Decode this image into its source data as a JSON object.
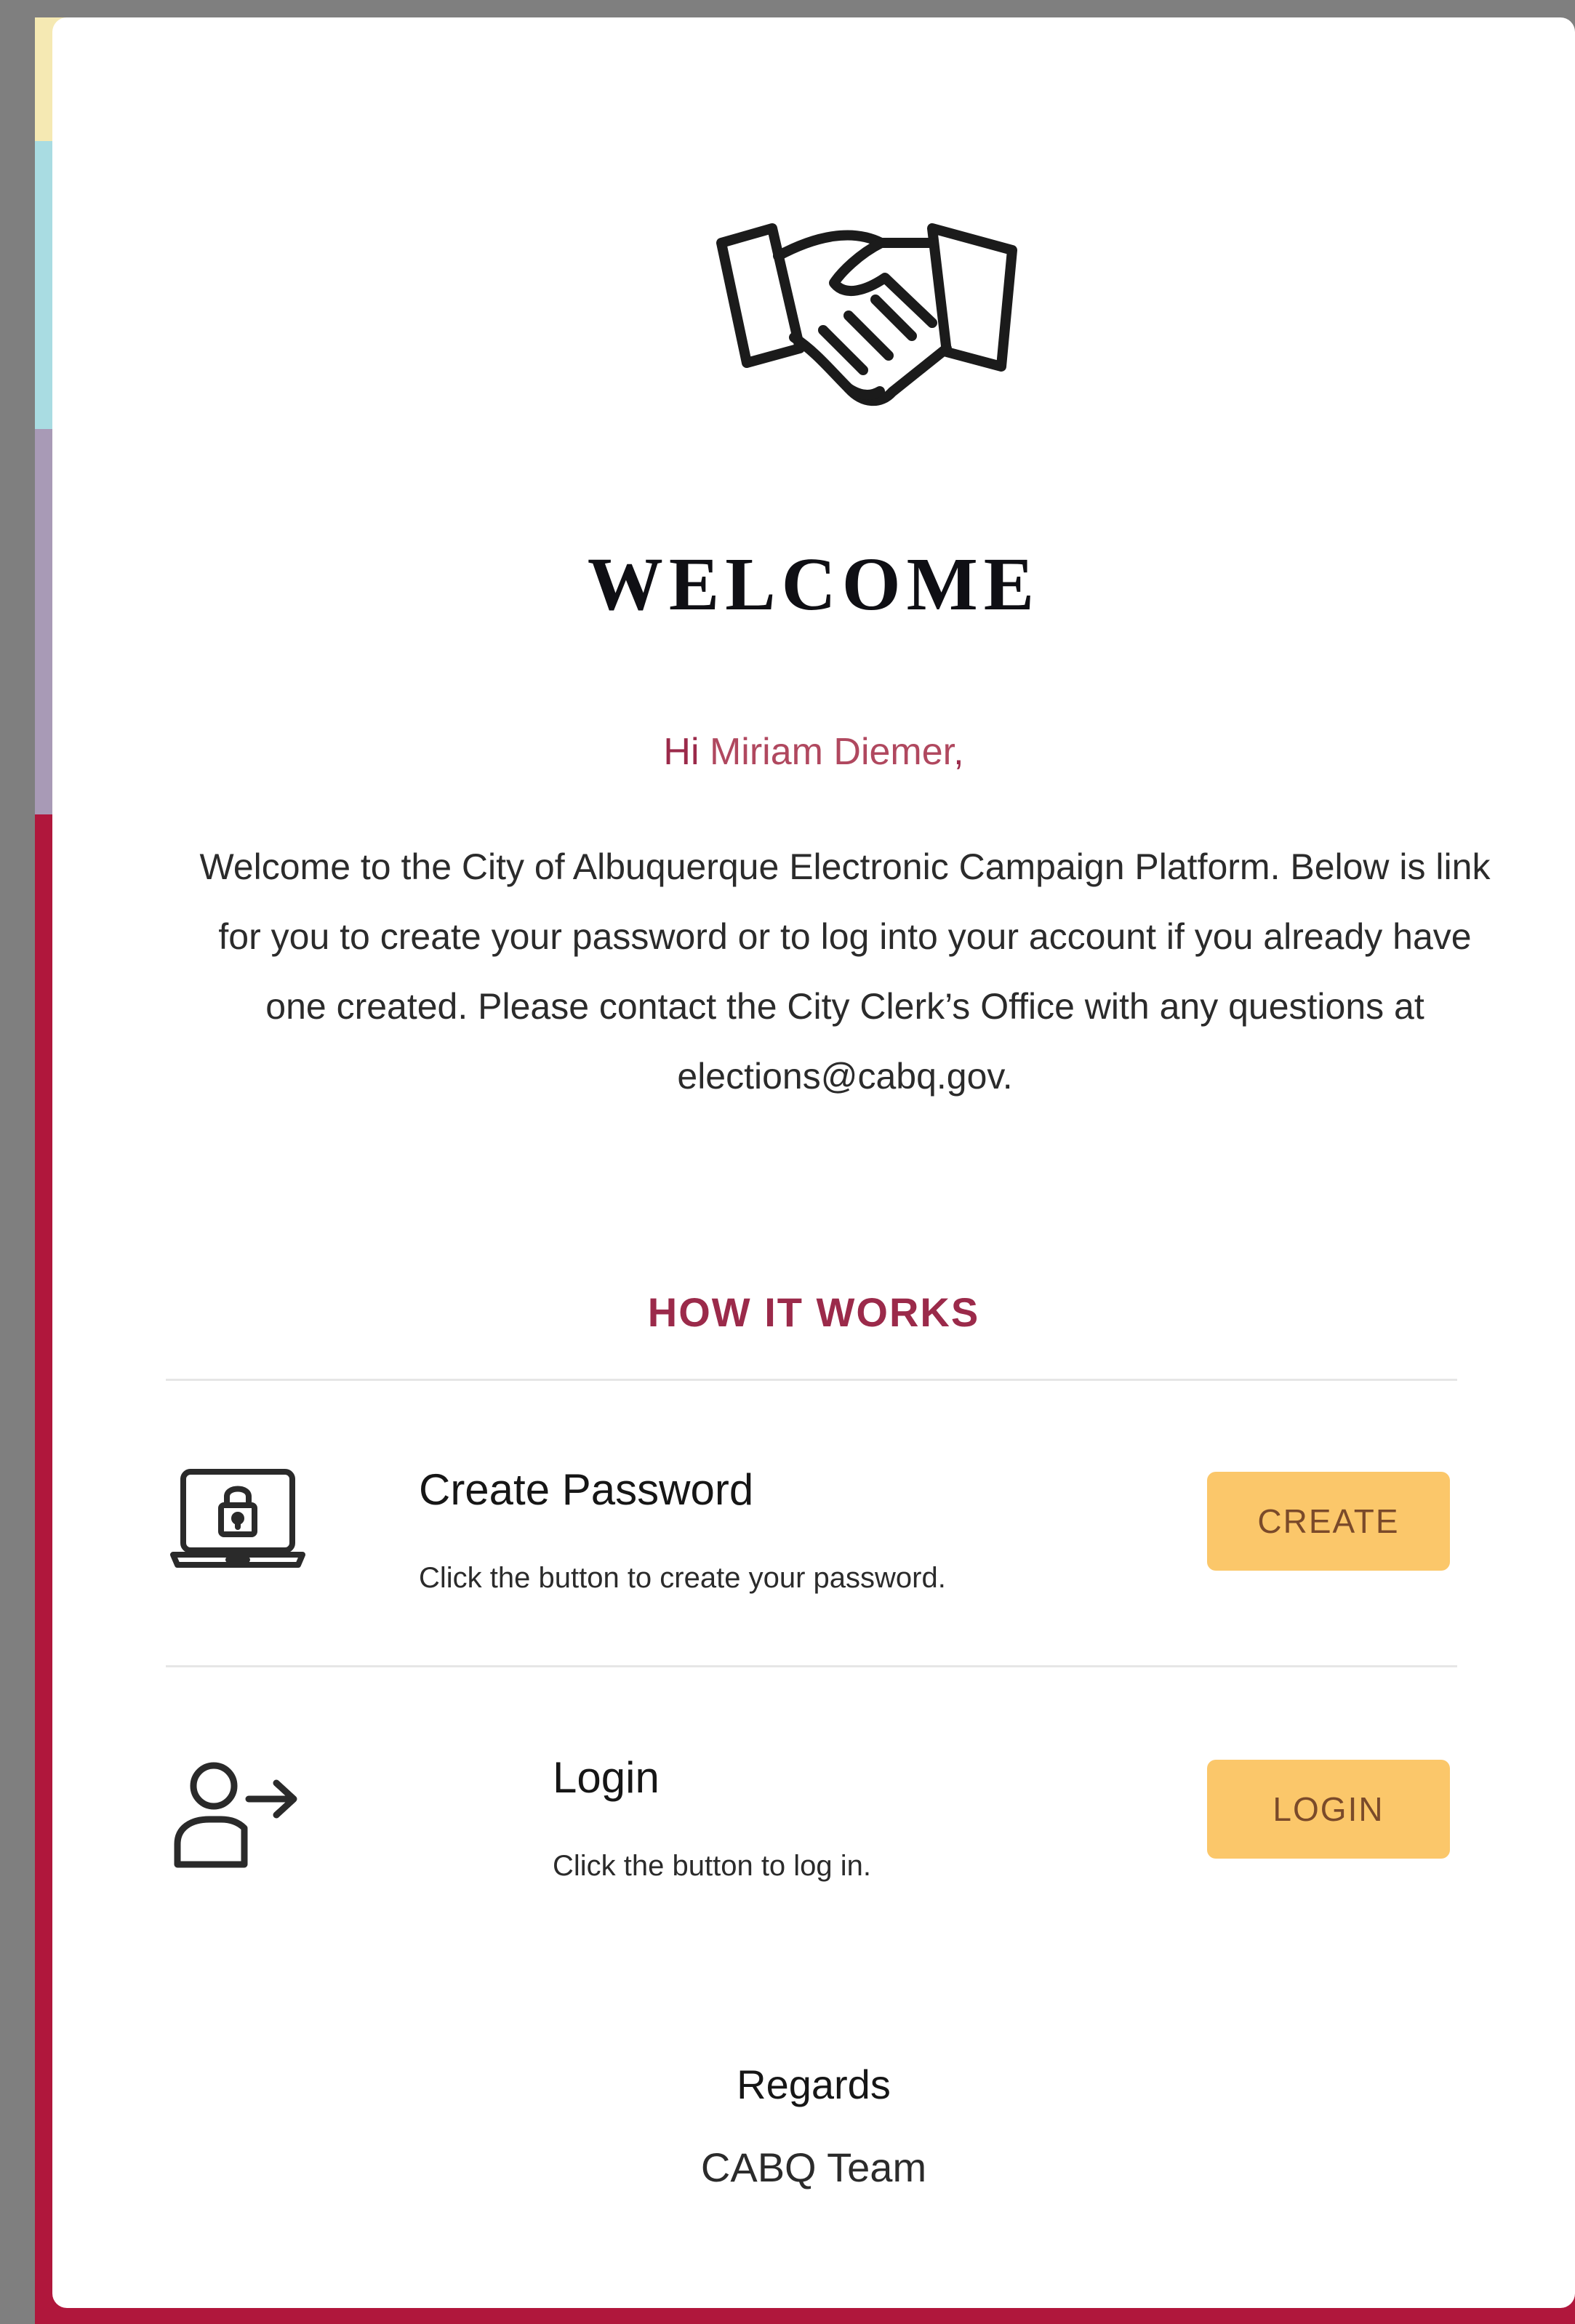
{
  "header": {
    "title": "WELCOME",
    "icon": "handshake-icon"
  },
  "greeting": {
    "prefix": "Hi ",
    "name": "Miriam Diemer",
    "suffix": ","
  },
  "intro": {
    "text": "Welcome to the City of Albuquerque Electronic Campaign Platform. Below is link for you to create your password or to log into your account if you already have one created. Please contact the City Clerk’s Office with any questions at elections@cabq.gov."
  },
  "how_it_works": {
    "title": "HOW IT WORKS",
    "steps": [
      {
        "icon": "laptop-lock-icon",
        "title": "Create Password",
        "description": "Click the button to create your password.",
        "button_label": "CREATE"
      },
      {
        "icon": "user-arrow-icon",
        "title": "Login",
        "description": "Click the button to log in.",
        "button_label": "LOGIN"
      }
    ]
  },
  "footer": {
    "regards": "Regards",
    "team": "CABQ Team"
  },
  "colors": {
    "accent": "#9b2a4a",
    "button": "#fbc76a",
    "button_text": "#7a4a2a",
    "background_red": "#b0173c"
  }
}
